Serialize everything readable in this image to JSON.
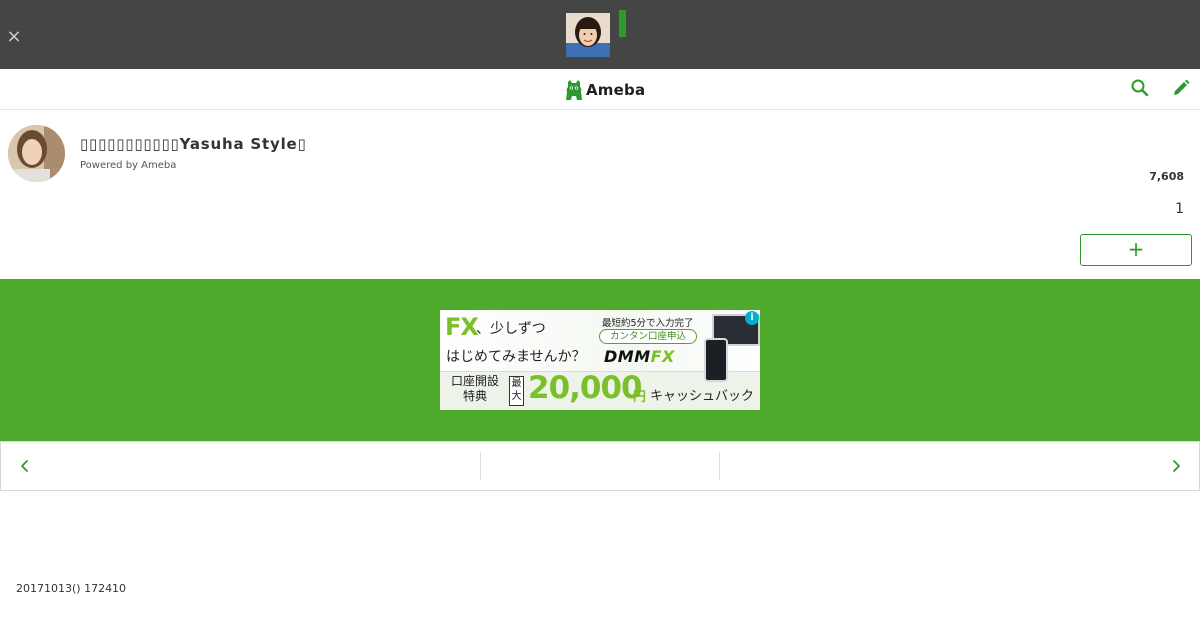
{
  "topbar": {
    "close_label": "×",
    "close_icon": "close-icon",
    "avatar_icon": "person-photo-icon",
    "indicator_color": "#2d9a2d"
  },
  "header": {
    "logo_text": "Ameba",
    "logo_icon": "ameba-logo-icon",
    "search_icon": "search-icon",
    "edit_icon": "pencil-icon",
    "brand_color": "#2d9a2d"
  },
  "profile": {
    "title": "▯▯▯▯▯▯▯▯▯▯▯Yasuha Style▯",
    "powered_by": "Powered by Ameba",
    "readers": "7,608",
    "posts": "1",
    "follow_label": "+"
  },
  "ad": {
    "band_color": "#4eaa2b",
    "fx": "FX",
    "line1": "、少しずつ",
    "line2": "はじめてみませんか？",
    "time_note": "最短約5分で入力完了",
    "pill": "カンタン口座申込",
    "brand_main": "DMM",
    "brand_fx": "FX",
    "info": "i",
    "perk": "口座開設 特典",
    "max": "最大",
    "amount": "20,000",
    "yen": "円",
    "cashback": "キャッシュバック"
  },
  "pager": {
    "prev_icon": "chevron-left-icon",
    "next_icon": "chevron-right-icon"
  },
  "post": {
    "date": "20171013() 172410"
  }
}
